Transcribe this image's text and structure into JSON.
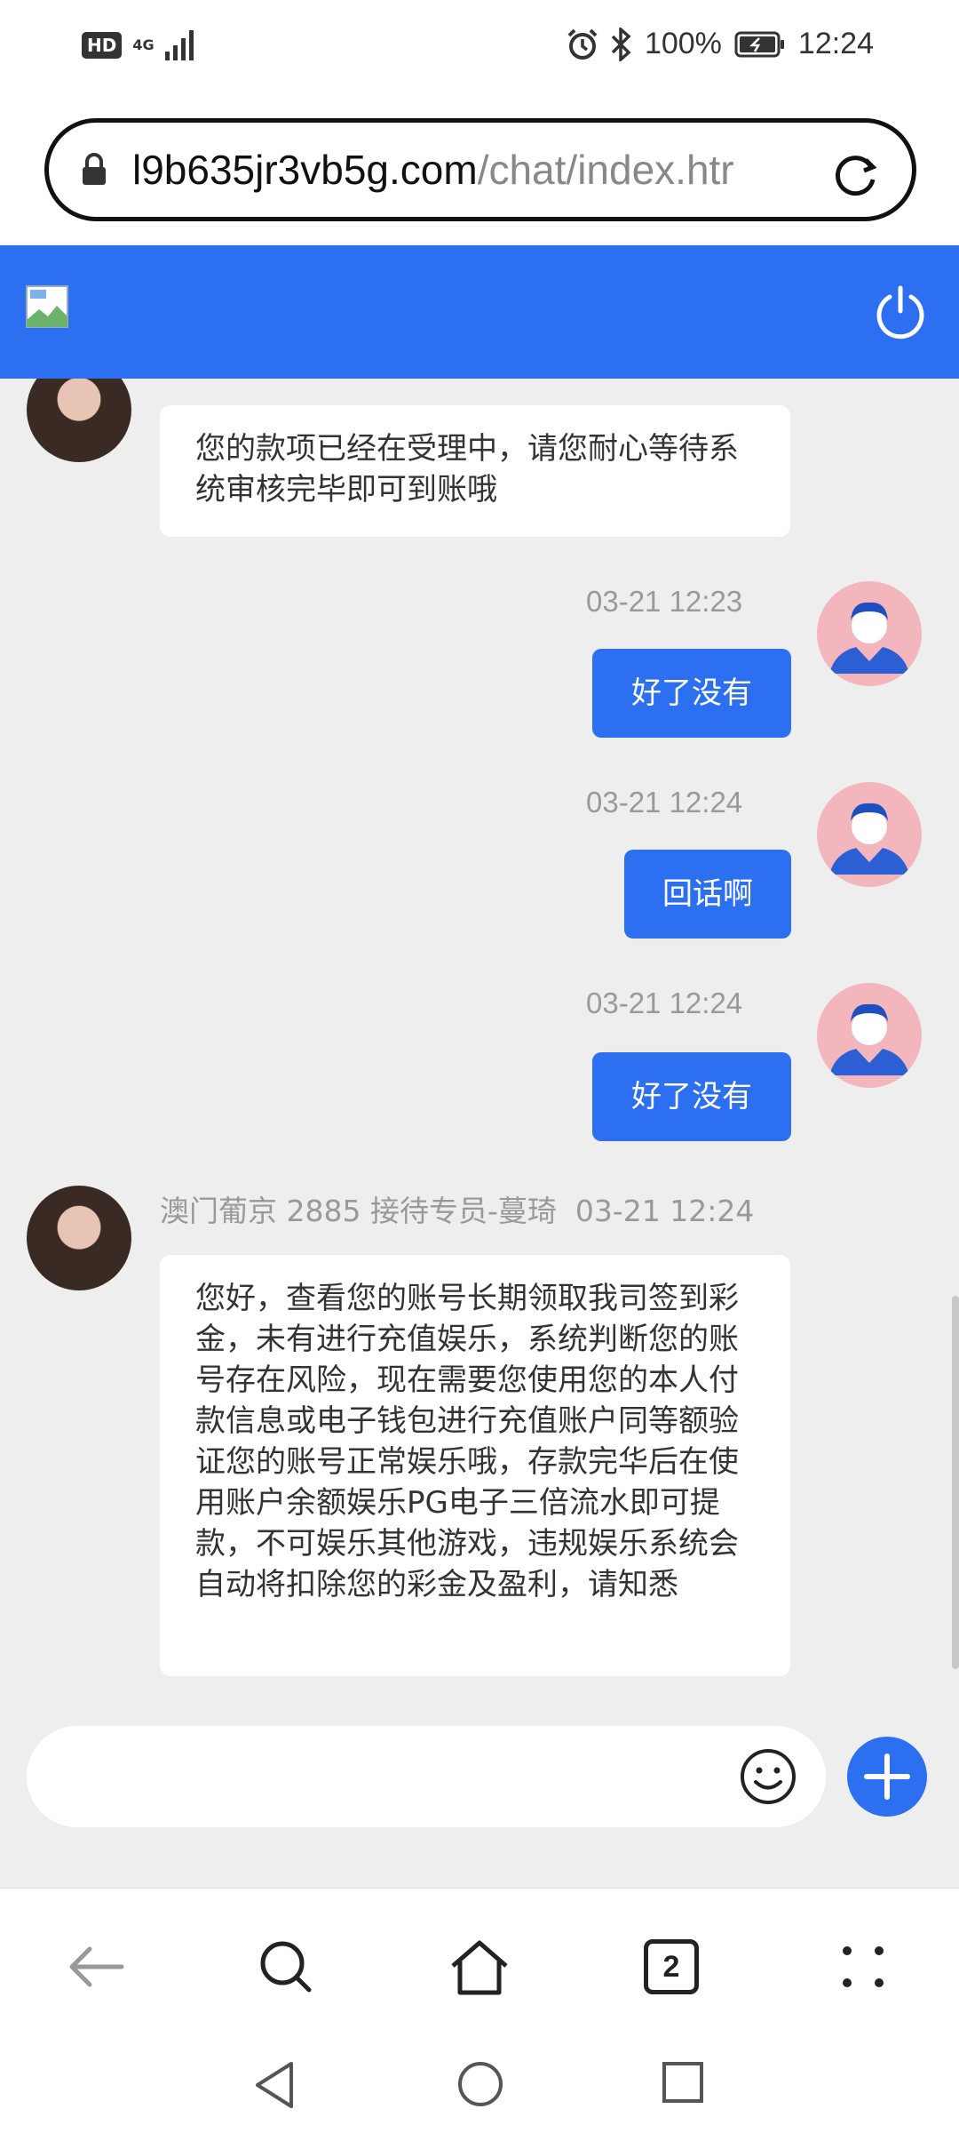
{
  "status_bar": {
    "hd": "HD",
    "network": "4G",
    "battery": "100%",
    "time": "12:24"
  },
  "browser": {
    "url_host": "l9b635jr3vb5g.com",
    "url_path": "/chat/index.htr",
    "tab_count": "2"
  },
  "chat": {
    "messages": [
      {
        "from": "agent",
        "text": "您的款项已经在受理中，请您耐心等待系统审核完毕即可到账哦"
      },
      {
        "from": "user",
        "time": "03-21 12:23",
        "text": "好了没有"
      },
      {
        "from": "user",
        "time": "03-21 12:24",
        "text": "回话啊"
      },
      {
        "from": "user",
        "time": "03-21 12:24",
        "text": "好了没有"
      },
      {
        "from": "agent",
        "sender": "澳门葡京 2885 接待专员-蔓琦",
        "time": "03-21 12:24",
        "text": "您好，查看您的账号长期领取我司签到彩金，未有进行充值娱乐，系统判断您的账号存在风险，现在需要您使用您的本人付款信息或电子钱包进行充值账户同等额验证您的账号正常娱乐哦，存款完华后在使用账户余额娱乐PG电子三倍流水即可提款，不可娱乐其他游戏，违规娱乐系统会自动将扣除您的彩金及盈利，请知悉"
      }
    ],
    "input_placeholder": ""
  },
  "colors": {
    "accent": "#2c6ff0",
    "chat_bg": "#eeeeee"
  },
  "icons": [
    "lock-icon",
    "reload-icon",
    "broken-image-icon",
    "power-icon",
    "emoji-icon",
    "plus-icon",
    "back-icon",
    "search-icon",
    "home-icon",
    "tabs-icon",
    "menu-icon"
  ]
}
